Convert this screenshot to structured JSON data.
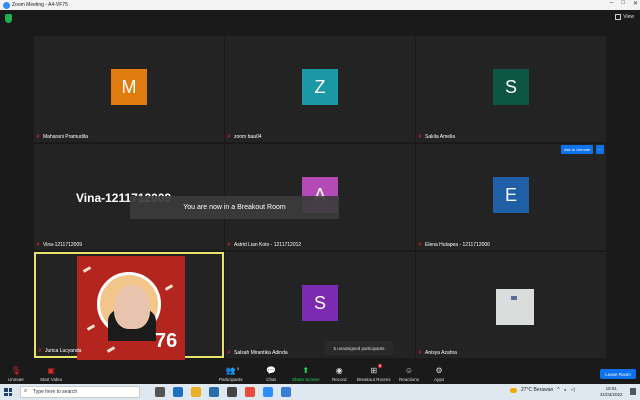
{
  "window": {
    "title": "Zoom Meeting - A4-VF75"
  },
  "topbar": {
    "view_label": "View"
  },
  "tiles": [
    {
      "name": "Maharani Pramudita",
      "initial": "M",
      "color": "#e07b0e"
    },
    {
      "name": "zoom baa04",
      "initial": "Z",
      "color": "#1b98a6"
    },
    {
      "name": "Sakila Amelia",
      "initial": "S",
      "color": "#0d5545"
    },
    {
      "name": "Vina-1211712009",
      "big_label": "Vina-1211712009"
    },
    {
      "name": "Astrid Lian Koto - 1211712012",
      "initial": "A",
      "color": "#b34ab6"
    },
    {
      "name": "Elena Hutapea - 1211712006",
      "initial": "E",
      "color": "#1f5fa6"
    },
    {
      "name": "Jurica Lucyanda"
    },
    {
      "name": "Salsah Mirantika Adinda",
      "initial": "S",
      "color": "#7d2ab3"
    },
    {
      "name": "Anisya Azahra"
    }
  ],
  "ask_to_unmute": "Ask to Unmute",
  "more_dots": "···",
  "toast": "You are now in a Breakout Room",
  "unassigned": "5 unassigned participants",
  "photo_number": "76",
  "toolbar": {
    "unmute": "Unmute",
    "start_video": "Start Video",
    "participants": "Participants",
    "participants_count": "5",
    "chat": "Chat",
    "share_screen": "Share Screen",
    "record": "Record",
    "breakout_rooms": "Breakout Rooms",
    "breakout_badge": "5",
    "reactions": "Reactions",
    "apps": "Apps",
    "leave_room": "Leave Room"
  },
  "taskbar": {
    "search_placeholder": "Type here to search",
    "weather": "27°C  Berawan",
    "time": "18:51",
    "date": "31/03/2022"
  }
}
